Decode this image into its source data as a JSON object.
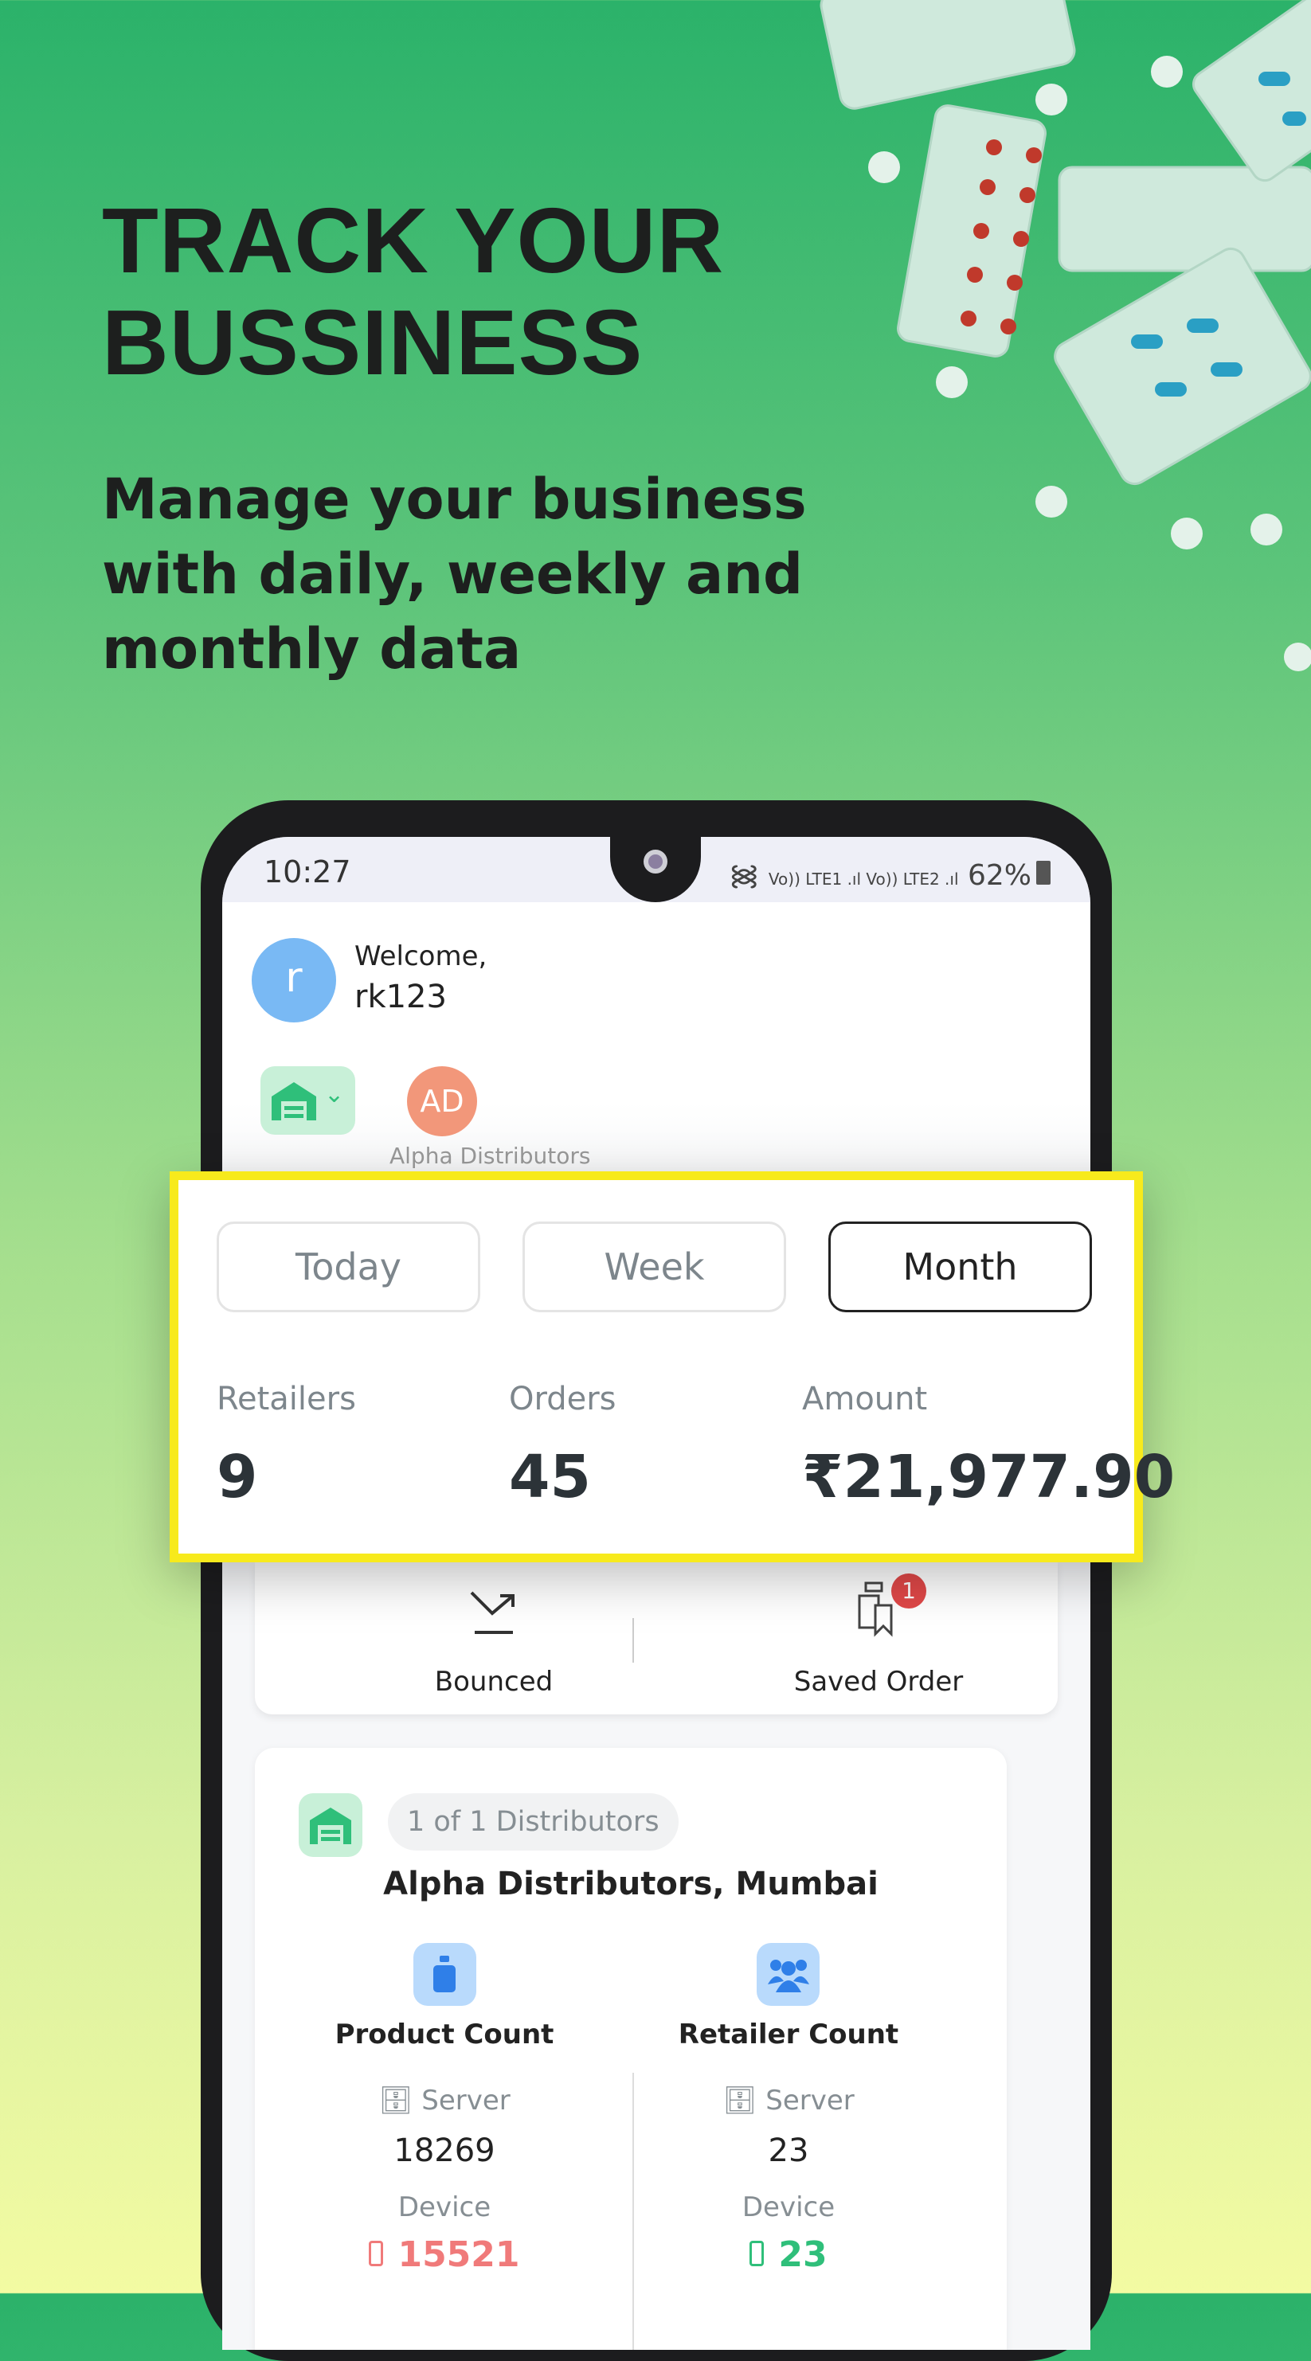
{
  "hero": {
    "title_line1": "TRACK YOUR",
    "title_line2": "BUSSINESS",
    "subtitle_line1": "Manage your business",
    "subtitle_line2": "with daily, weekly and",
    "subtitle_line3": "monthly data"
  },
  "status_bar": {
    "time": "10:27",
    "network": "Vo)) LTE1 .ıl Vo)) LTE2 .ıl",
    "battery": "62%"
  },
  "header": {
    "avatar_letter": "r",
    "welcome": "Welcome,",
    "username": "rk123"
  },
  "distributor_chip": {
    "initials": "AD",
    "label": "Alpha Distributors"
  },
  "period_tabs": [
    {
      "label": "Today",
      "active": false
    },
    {
      "label": "Week",
      "active": false
    },
    {
      "label": "Month",
      "active": true
    }
  ],
  "stats": [
    {
      "label": "Retailers",
      "value": "9"
    },
    {
      "label": "Orders",
      "value": "45"
    },
    {
      "label": "Amount",
      "value": "₹21,977.90"
    }
  ],
  "quick_actions": [
    {
      "label": "Bounced",
      "icon": "bounced-icon"
    },
    {
      "label": "Saved Order",
      "icon": "saved-order-icon",
      "badge": "1"
    }
  ],
  "distributor_card": {
    "counter": "1 of 1 Distributors",
    "name": "Alpha Distributors, Mumbai",
    "product": {
      "title": "Product Count",
      "server_label": "Server",
      "server_value": "18269",
      "device_label": "Device",
      "device_value": "15521"
    },
    "retailer": {
      "title": "Retailer Count",
      "server_label": "Server",
      "server_value": "23",
      "device_label": "Device",
      "device_value": "23"
    }
  },
  "colors": {
    "accent_green": "#2fbf7a",
    "device_red": "#f07a7a",
    "highlight_yellow": "#f7ea1c",
    "icon_blue": "#2f7fe8"
  }
}
